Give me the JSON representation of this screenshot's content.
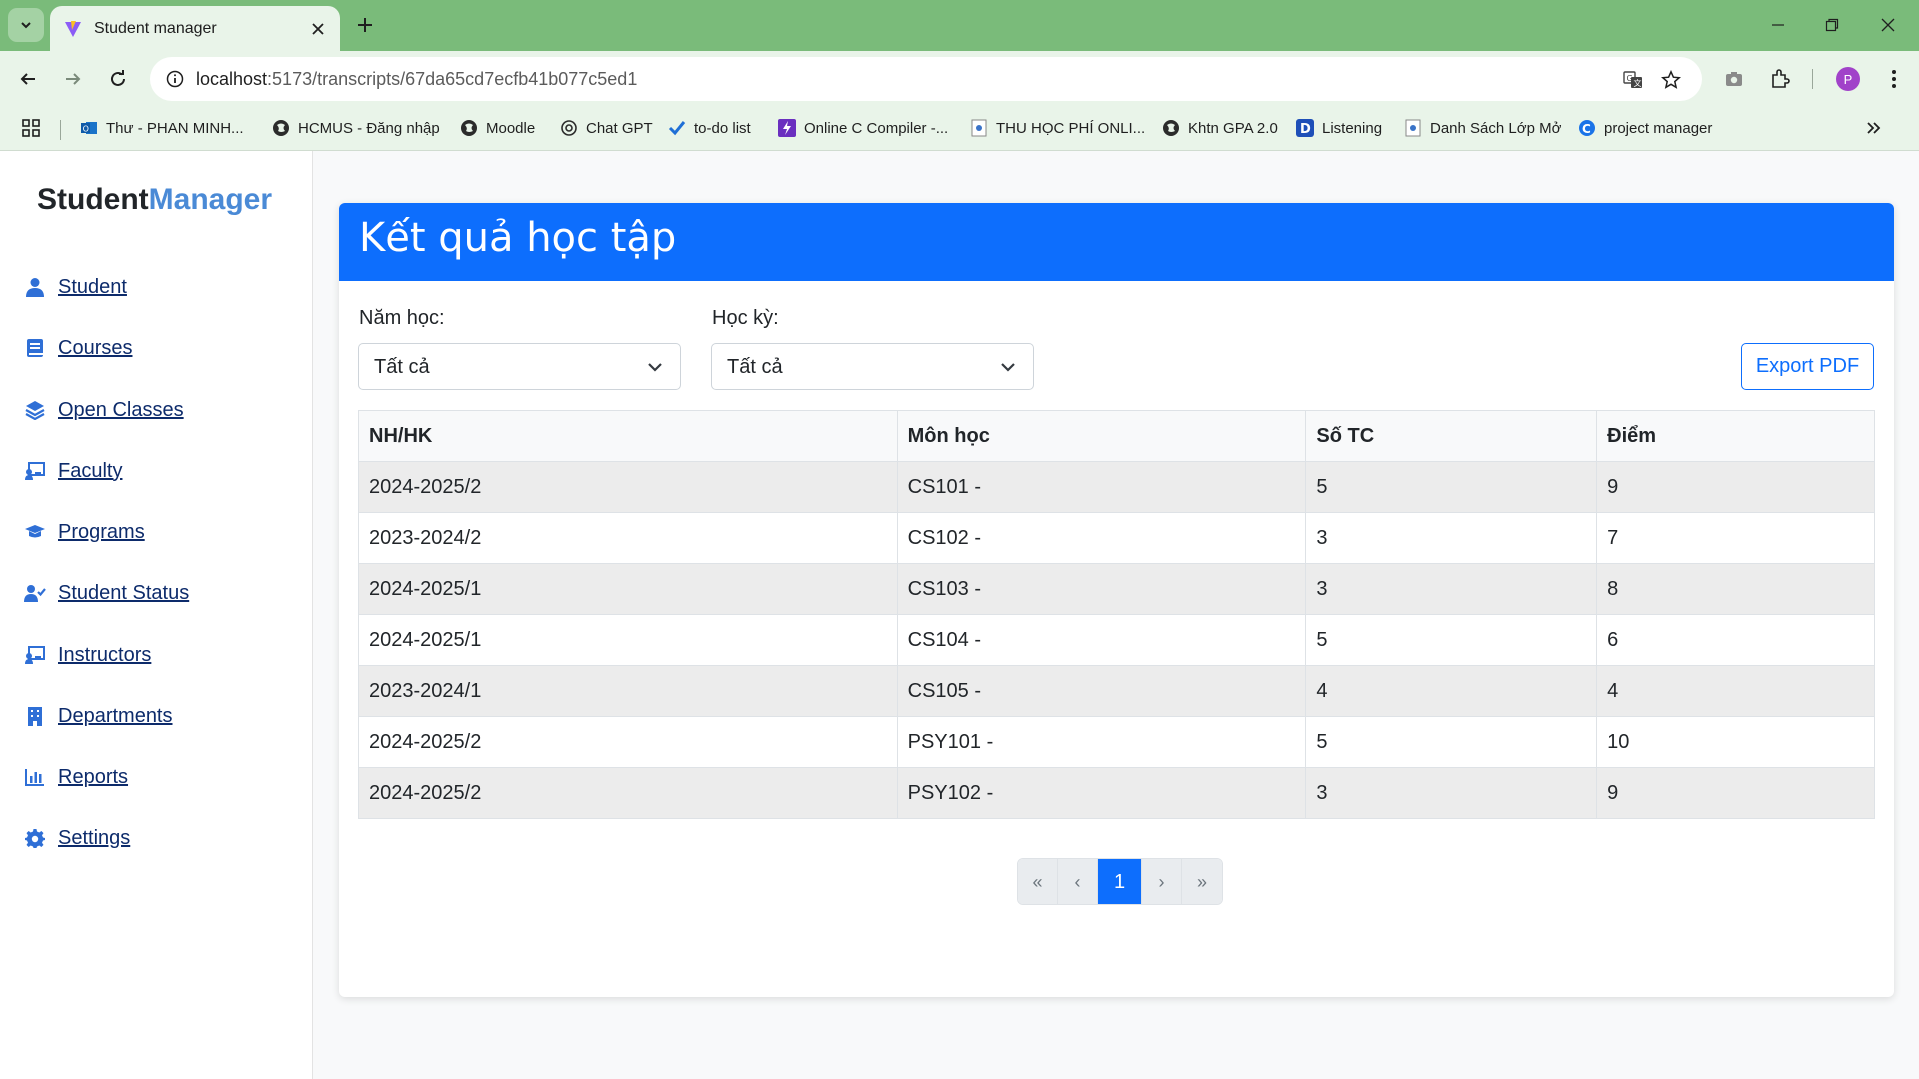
{
  "browser": {
    "tab_title": "Student manager",
    "url_host": "localhost",
    "url_path": ":5173/transcripts/67da65cd7ecfb41b077c5ed1",
    "avatar_letter": "P",
    "bookmarks": [
      {
        "label": "Thư - PHAN MINH...",
        "icon": "outlook-icon"
      },
      {
        "label": "HCMUS - Đăng nhập",
        "icon": "globe-icon"
      },
      {
        "label": "Moodle",
        "icon": "globe-icon"
      },
      {
        "label": "Chat GPT",
        "icon": "openai-icon"
      },
      {
        "label": "to-do list",
        "icon": "check-icon"
      },
      {
        "label": "Online C Compiler -...",
        "icon": "bolt-icon"
      },
      {
        "label": "THU HỌC PHÍ ONLI...",
        "icon": "page-icon"
      },
      {
        "label": "Khtn GPA 2.0",
        "icon": "globe-icon"
      },
      {
        "label": "Listening",
        "icon": "d-icon"
      },
      {
        "label": "Danh Sách Lớp Mở",
        "icon": "page-icon"
      },
      {
        "label": "project manager",
        "icon": "c-icon"
      }
    ]
  },
  "sidebar": {
    "brand_dark": "Student",
    "brand_accent": "Manager",
    "items": [
      {
        "label": "Student",
        "icon": "user-icon"
      },
      {
        "label": "Courses",
        "icon": "book-icon"
      },
      {
        "label": "Open Classes",
        "icon": "layers-icon"
      },
      {
        "label": "Faculty",
        "icon": "chalkboard-icon"
      },
      {
        "label": "Programs",
        "icon": "graduation-cap-icon"
      },
      {
        "label": "Student Status",
        "icon": "user-check-icon"
      },
      {
        "label": "Instructors",
        "icon": "chalkboard-teacher-icon"
      },
      {
        "label": "Departments",
        "icon": "building-icon"
      },
      {
        "label": "Reports",
        "icon": "chart-icon"
      },
      {
        "label": "Settings",
        "icon": "gear-icon"
      }
    ]
  },
  "main": {
    "title": "Kết quả học tập",
    "filters": {
      "year_label": "Năm học:",
      "year_value": "Tất cả",
      "semester_label": "Học kỳ:",
      "semester_value": "Tất cả"
    },
    "export_label": "Export PDF",
    "table": {
      "headers": [
        "NH/HK",
        "Môn học",
        "Số TC",
        "Điểm"
      ],
      "rows": [
        [
          "2024-2025/2",
          "CS101 -",
          "5",
          "9"
        ],
        [
          "2023-2024/2",
          "CS102 -",
          "3",
          "7"
        ],
        [
          "2024-2025/1",
          "CS103 -",
          "3",
          "8"
        ],
        [
          "2024-2025/1",
          "CS104 -",
          "5",
          "6"
        ],
        [
          "2023-2024/1",
          "CS105 -",
          "4",
          "4"
        ],
        [
          "2024-2025/2",
          "PSY101 -",
          "5",
          "10"
        ],
        [
          "2024-2025/2",
          "PSY102 -",
          "3",
          "9"
        ]
      ]
    },
    "pagination": {
      "first": "«",
      "prev": "‹",
      "current": "1",
      "next": "›",
      "last": "»"
    }
  },
  "colors": {
    "primary": "#0d6efd",
    "brand_accent": "#4a8ad6",
    "chrome_green": "#7abb7a"
  }
}
